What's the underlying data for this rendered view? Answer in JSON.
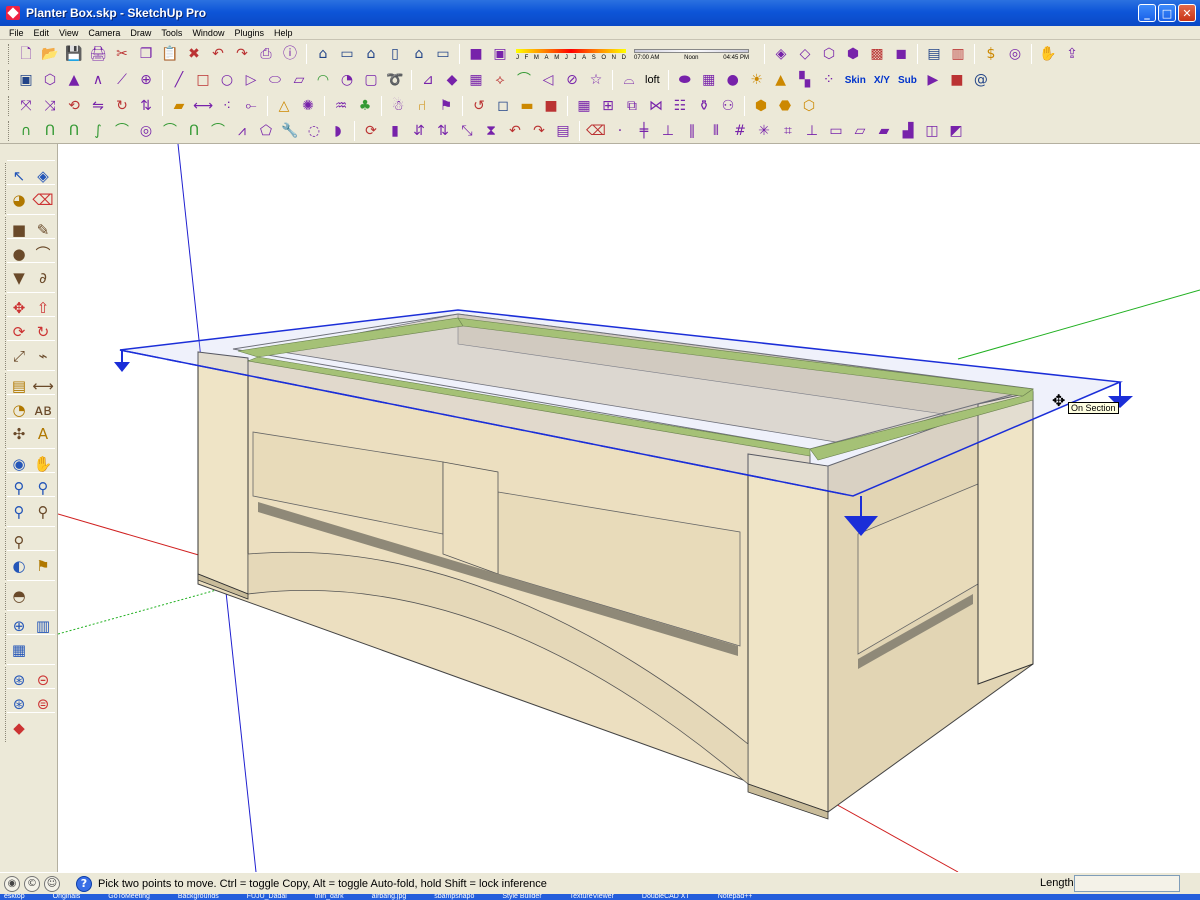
{
  "window": {
    "title": "Planter Box.skp - SketchUp Pro",
    "buttons": {
      "minimize": "_",
      "maximize": "□",
      "close": "✕"
    }
  },
  "menu": [
    "File",
    "Edit",
    "View",
    "Camera",
    "Draw",
    "Tools",
    "Window",
    "Plugins",
    "Help"
  ],
  "shadows": {
    "months": [
      "J",
      "F",
      "M",
      "A",
      "M",
      "J",
      "J",
      "A",
      "S",
      "O",
      "N",
      "D"
    ],
    "time_start": "07:00 AM",
    "time_mid": "Noon",
    "time_end": "04:45 PM"
  },
  "toolbar_labels": {
    "loft": "loft",
    "skin": "Skin",
    "xy": "X/Y",
    "sub": "Sub"
  },
  "icons": {
    "row1": [
      "new-file-icon",
      "open-folder-icon",
      "save-icon",
      "print-icon",
      "cut-icon",
      "copy-icon",
      "paste-icon",
      "erase-icon",
      "undo-icon",
      "redo-icon",
      "printer-icon",
      "model-info-icon",
      "iso-view-icon",
      "top-view-icon",
      "front-view-icon",
      "right-view-icon",
      "back-view-icon",
      "left-view-icon",
      "component-icon",
      "material-icon",
      "xray-icon",
      "wireframe-icon",
      "hidden-line-icon",
      "shaded-icon",
      "textured-icon",
      "monochrome-icon",
      "section-plane-icon",
      "section-cut-icon",
      "sandbox-icon",
      "plugin-icon",
      "pan-hand-icon",
      "export-icon"
    ],
    "row2": [
      "cube-icon",
      "polyhedron-icon",
      "tetra-icon",
      "angle-icon",
      "line-tool-icon",
      "axes-icon",
      "line-icon",
      "rectangle-icon",
      "circle-icon",
      "triangle-icon",
      "ellipse-icon",
      "parallelogram-icon",
      "arc-icon",
      "pie-icon",
      "offset-square-icon",
      "spiral-icon",
      "stretch-icon",
      "gem-icon",
      "texture-icon",
      "fan-icon",
      "curve-icon",
      "cone-icon",
      "lathe-icon",
      "star-icon",
      "bridge-icon",
      "soap-icon",
      "grid-icon",
      "sphere-icon",
      "light-icon",
      "triangle-yellow-icon",
      "color-squares-icon",
      "color-dots-icon",
      "play-icon",
      "stop-icon",
      "spiral-blue-icon"
    ],
    "row3": [
      "axis-flip-icon",
      "axis-arrow-icon",
      "axis-rotate-icon",
      "mirror-icon",
      "rotate-icon",
      "align-up-icon",
      "box-icon",
      "dimension-icon",
      "node-icon",
      "joint-icon",
      "pyramid-icon",
      "burst-icon",
      "water-icon",
      "trees-icon",
      "people-icon",
      "chair-icon",
      "flag-icon",
      "rotate-orange-icon",
      "cube-outline-icon",
      "brick-icon",
      "red-cube-icon",
      "mesh-icon",
      "cross-mesh-icon",
      "frame-icon",
      "rebar-icon",
      "fence-icon",
      "bottle-icon",
      "joints-icon",
      "box-gold-icon",
      "box-split-icon",
      "box-green-icon"
    ],
    "row4": [
      "bezier-1-icon",
      "bezier-2-icon",
      "bezier-3-icon",
      "bezier-4-icon",
      "curve-arc-icon",
      "spiral-circle-icon",
      "arc-2-icon",
      "curve-n-icon",
      "arch-icon",
      "zigzag-icon",
      "polygon-icon",
      "wrench-icon",
      "lasso-icon",
      "half-circle-icon",
      "rotate-cube-icon",
      "column-icon",
      "move-arrows-icon",
      "reverse-arrows-icon",
      "scale-icon",
      "hourglass-icon",
      "undo-arc-icon",
      "redo-arc-icon",
      "document-icon",
      "eraser-pink-icon",
      "dot-icon",
      "cross-line-icon",
      "ortho-line-icon",
      "parallel-icon",
      "align-icon",
      "grid-small-icon",
      "star-axis-icon",
      "hash-icon",
      "floor-icon",
      "rect-outline-icon",
      "slab-icon",
      "block-icon",
      "stair-icon",
      "block-pair-icon",
      "stack-icon"
    ]
  },
  "left_tools": [
    [
      "select-arrow-icon",
      "component-box-icon"
    ],
    [
      "paint-bucket-icon",
      "eraser-icon"
    ],
    [
      "rectangle-tool-icon",
      "pencil-icon"
    ],
    [
      "circle-tool-icon",
      "arc-tool-icon"
    ],
    [
      "polygon-tool-icon",
      "freehand-icon"
    ],
    [
      "move-tool-icon",
      "push-pull-icon"
    ],
    [
      "rotate-tool-icon",
      "follow-me-icon"
    ],
    [
      "scale-tool-icon",
      "offset-tool-icon"
    ],
    [
      "tape-measure-icon",
      "dimension-tool-icon"
    ],
    [
      "protractor-icon",
      "text-tool-icon"
    ],
    [
      "axes-tool-icon",
      "3d-text-icon"
    ],
    [
      "orbit-icon",
      "pan-icon"
    ],
    [
      "zoom-icon",
      "zoom-window-icon"
    ],
    [
      "zoom-extents-icon",
      "previous-view-icon"
    ],
    [
      "next-view-icon"
    ],
    [
      "position-camera-icon",
      "walk-icon"
    ],
    [
      "look-around-icon"
    ],
    [
      "section-plane-tool-icon",
      "section-display-icon"
    ],
    [
      "section-fill-icon"
    ],
    [
      "get-models-icon",
      "share-model-icon"
    ],
    [
      "get-component-icon",
      "share-component-icon"
    ],
    [
      "ruby-icon"
    ]
  ],
  "viewport": {
    "tooltip": "On Section",
    "cursor": "move-cursor-icon"
  },
  "status": {
    "icons": [
      "geo-location-icon",
      "credits-icon",
      "user-icon"
    ],
    "help_icon": "?",
    "message": "Pick two points to move.  Ctrl = toggle Copy, Alt = toggle Auto-fold, hold Shift = lock inference",
    "measurement_label": "Length",
    "measurement_value": ""
  },
  "taskbar": [
    "esktop",
    "Originals",
    "GoToMeeting",
    "Backgrounds",
    "FUJU_Dadai",
    "thin_dark",
    "airbang.jpg",
    "sbampshapo",
    "Style Builder",
    "TextureViewer",
    "DoubleCAD XT",
    "Notepad++"
  ],
  "colors": {
    "titlebar": "#0d55d8",
    "chrome": "#ece9d8",
    "wood": "#ecdfc0",
    "wood_shade": "#d9cbaa",
    "section_cut": "#9cbf4e",
    "section_plane": "#1b2ed8",
    "axis_red": "#d02020",
    "axis_green": "#20b020",
    "axis_blue": "#2020d0"
  }
}
